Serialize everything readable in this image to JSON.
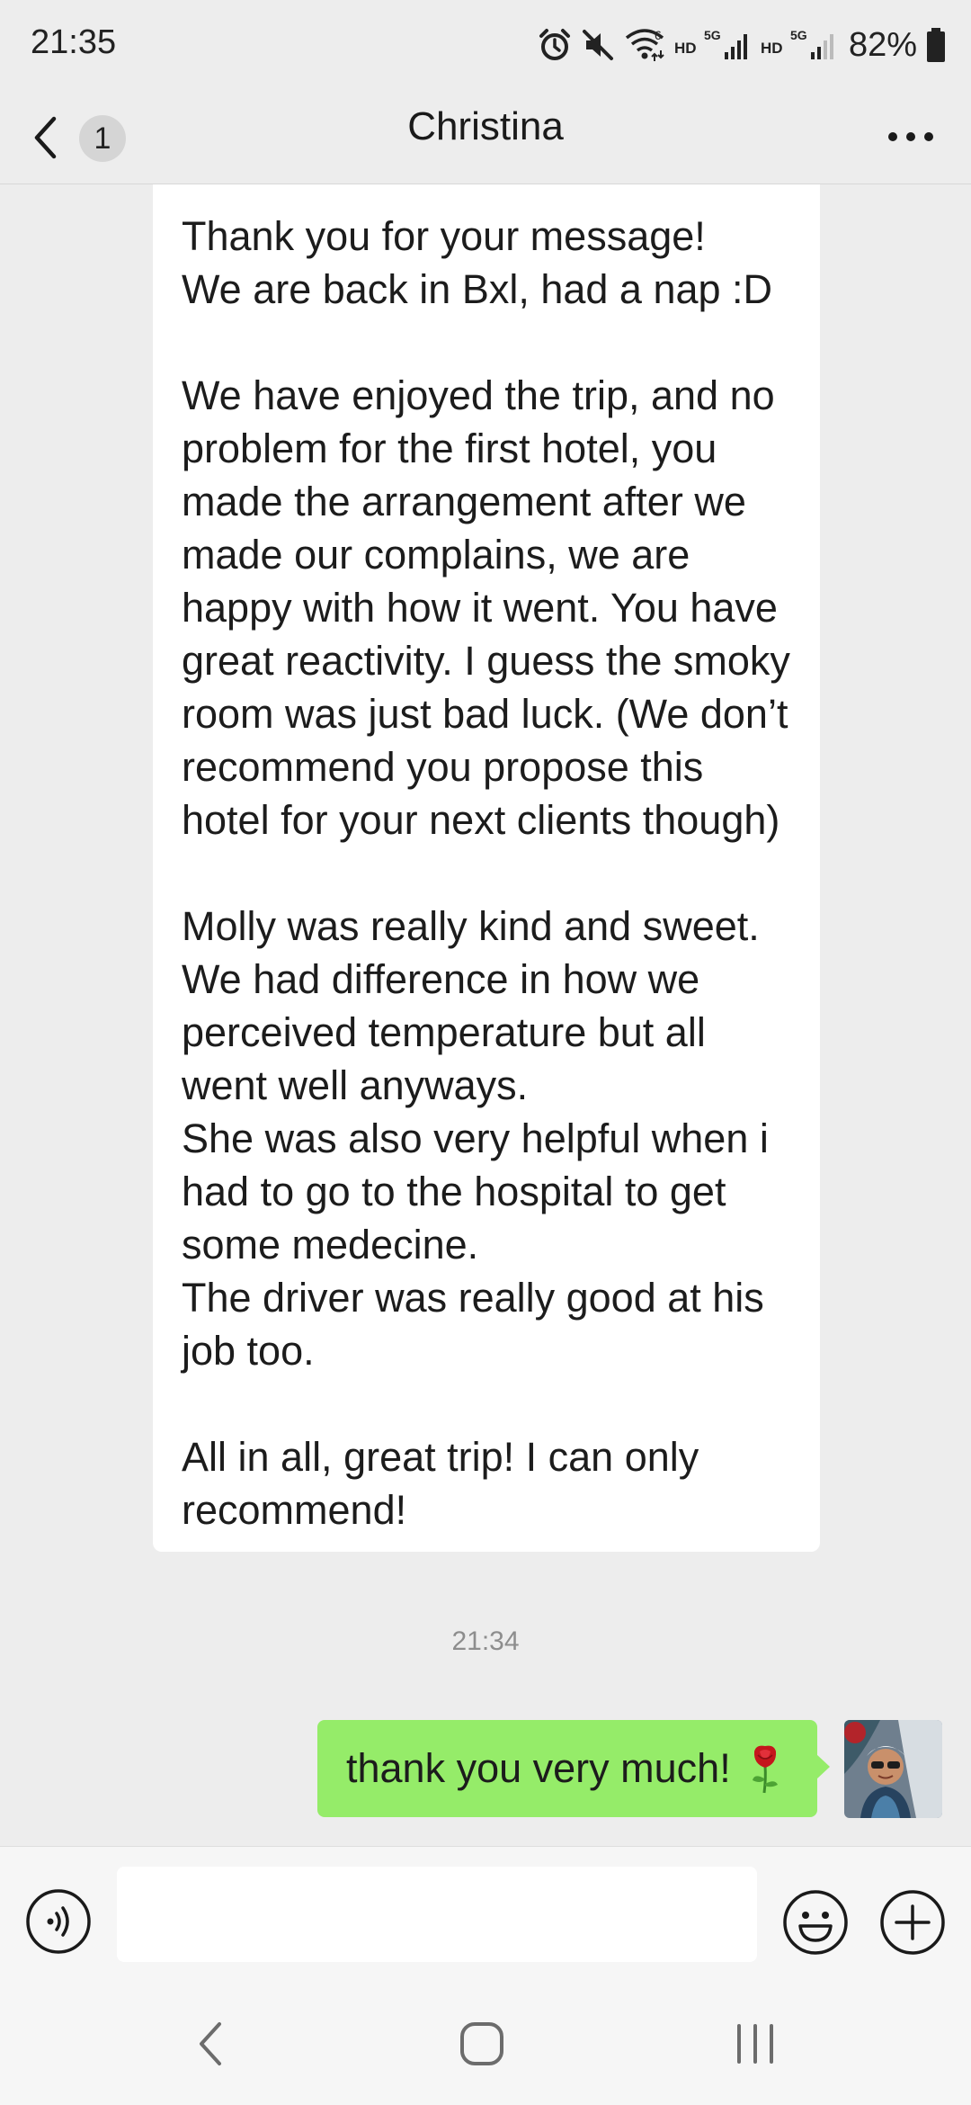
{
  "status_bar": {
    "time": "21:35",
    "battery": "82%",
    "icons": [
      "alarm-icon",
      "mute-icon",
      "wifi-icon",
      "hd-5g-signal-icon",
      "hd-5g-signal-icon",
      "battery-icon"
    ],
    "network_labels": [
      "HD",
      "5G",
      "HD",
      "5G",
      "6"
    ]
  },
  "header": {
    "unread_count": "1",
    "title": "Christina"
  },
  "messages": {
    "incoming_text": "Thank you for your message!\nWe are back in Bxl, had a nap :D\n\nWe have enjoyed the trip, and no problem for the first hotel, you made the arrangement after we made our complains, we are happy with how it went. You have great reactivity. I guess the smoky room was just bad luck. (We don’t recommend you propose this hotel for your next clients though)\n\nMolly was really kind and sweet. We had difference in how we perceived temperature but all went well anyways.\nShe was also very helpful when i had to go to the hospital to get some medecine.\nThe driver was really good at his job too.\n\nAll in all, great trip! I can only recommend!",
    "timestamp": "21:34",
    "outgoing_text": "thank you very much!",
    "outgoing_emoji": "rose-icon"
  },
  "input_bar": {
    "value": "",
    "icons": [
      "voice-icon",
      "emoji-icon",
      "plus-icon"
    ]
  },
  "colors": {
    "background": "#ededed",
    "incoming_bubble": "#ffffff",
    "outgoing_bubble": "#95ec69",
    "timestamp_text": "#8d8d8d"
  }
}
